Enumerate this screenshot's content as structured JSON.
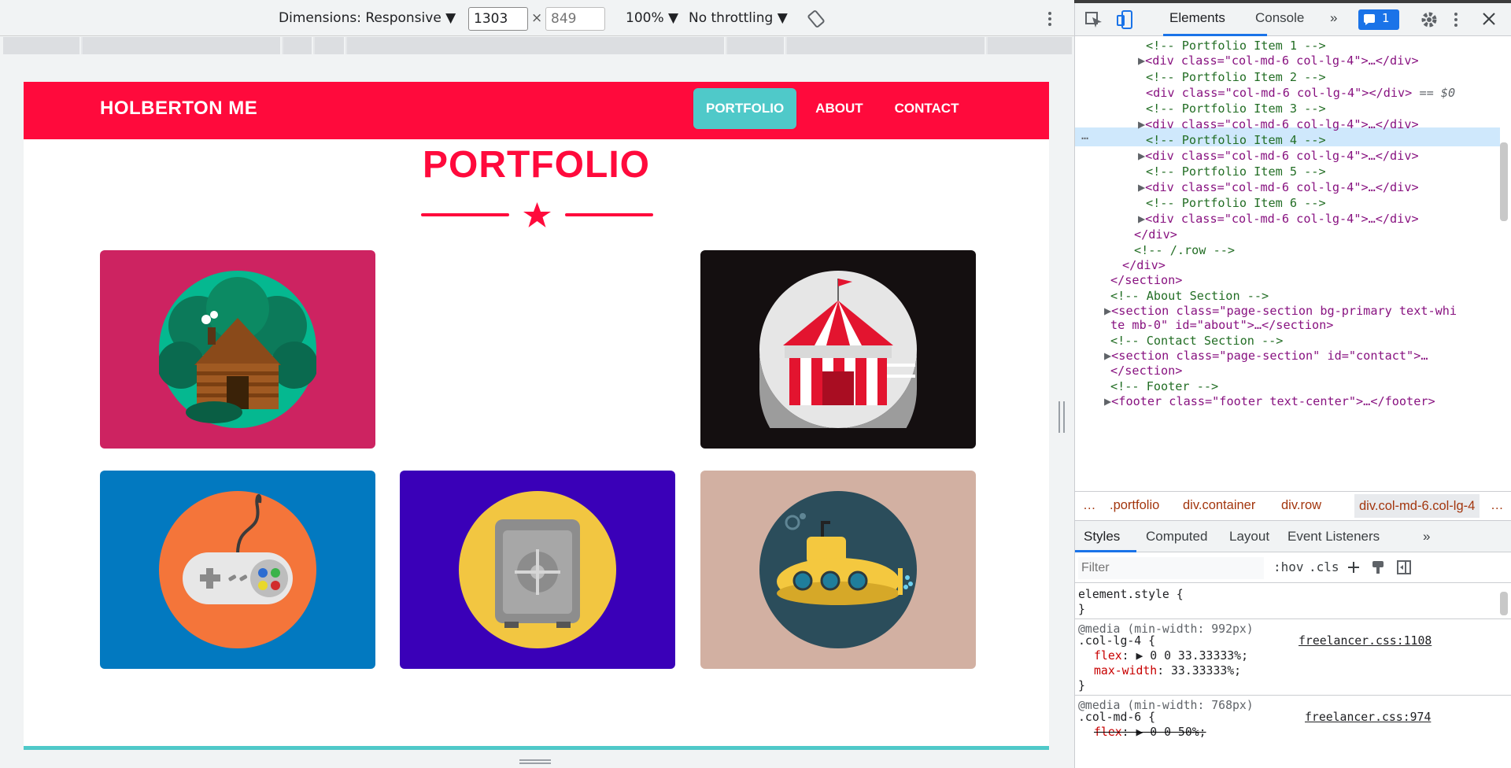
{
  "device_toolbar": {
    "dimensions_label": "Dimensions: Responsive ▼",
    "width_value": "1303",
    "times": "×",
    "height_placeholder": "849",
    "zoom": "100% ▼",
    "throttling": "No throttling ▼"
  },
  "site": {
    "brand": "HOLBERTON ME",
    "nav": [
      {
        "label": "PORTFOLIO",
        "active": true
      },
      {
        "label": "ABOUT",
        "active": false
      },
      {
        "label": "CONTACT",
        "active": false
      }
    ],
    "heading": "PORTFOLIO",
    "accent": "#ff0a3c",
    "secondary": "#4fc9c9",
    "portfolio_items": [
      {
        "name": "cabin",
        "bg": "#cd2361"
      },
      {
        "name": "empty",
        "bg": "#ffffff"
      },
      {
        "name": "circus-tent",
        "bg": "#140f10"
      },
      {
        "name": "game-controller",
        "bg": "#0279c0"
      },
      {
        "name": "safe",
        "bg": "#3a00b8"
      },
      {
        "name": "submarine",
        "bg": "#d2b0a2"
      }
    ]
  },
  "devtools": {
    "tabs": [
      "Elements",
      "Console"
    ],
    "more_tabs": "»",
    "issues_count": "1",
    "dom_lines": [
      {
        "t": "<!-- Portfolio Item 1 -->"
      },
      {
        "t": "<div class=\"col-md-6 col-lg-4\">…</div>"
      },
      {
        "t": "<!-- Portfolio Item 2 -->"
      },
      {
        "t": "<div class=\"col-md-6 col-lg-4\"></div>"
      },
      {
        "t": "== $0"
      },
      {
        "t": "<!-- Portfolio Item 3 -->"
      },
      {
        "t": "<div class=\"col-md-6 col-lg-4\">…</div>"
      },
      {
        "t": "<!-- Portfolio Item 4 -->"
      },
      {
        "t": "<div class=\"col-md-6 col-lg-4\">…</div>"
      },
      {
        "t": "<!-- Portfolio Item 5 -->"
      },
      {
        "t": "<div class=\"col-md-6 col-lg-4\">…</div>"
      },
      {
        "t": "<!-- Portfolio Item 6 -->"
      },
      {
        "t": "<div class=\"col-md-6 col-lg-4\">…</div>"
      },
      {
        "t": "</div>"
      },
      {
        "t": "<!-- /.row -->"
      },
      {
        "t": "</div>"
      },
      {
        "t": "</section>"
      },
      {
        "t": "<!-- About Section -->"
      },
      {
        "t": "<section class=\"page-section bg-primary text-whi"
      },
      {
        "t": "te mb-0\" id=\"about\">…</section>"
      },
      {
        "t": "<!-- Contact Section -->"
      },
      {
        "t": "<section class=\"page-section\" id=\"contact\">…"
      },
      {
        "t": "</section>"
      },
      {
        "t": "<!-- Footer -->"
      },
      {
        "t": "<footer class=\"footer text-center\">…</footer>"
      }
    ],
    "breadcrumbs": [
      ".portfolio",
      "div.container",
      "div.row",
      "div.col-md-6.col-lg-4"
    ],
    "sub_tabs": [
      "Styles",
      "Computed",
      "Layout",
      "Event Listeners",
      "»"
    ],
    "filter_placeholder": "Filter",
    "hov": ":hov",
    "cls": ".cls",
    "styles": {
      "element_style": "element.style {",
      "close": "}",
      "rule1_media": "@media (min-width: 992px)",
      "rule1_selector": ".col-lg-4 {",
      "rule1_source": "freelancer.css:1108",
      "rule1_p1_name": "flex",
      "rule1_p1_value": ": ▶ 0 0 33.33333%;",
      "rule1_p2_name": "max-width",
      "rule1_p2_value": ": 33.33333%;",
      "rule2_media": "@media (min-width: 768px)",
      "rule2_selector": ".col-md-6 {",
      "rule2_source": "freelancer.css:974",
      "rule2_p1_name": "flex",
      "rule2_p1_value": ": ▶ 0 0 50%;"
    }
  }
}
